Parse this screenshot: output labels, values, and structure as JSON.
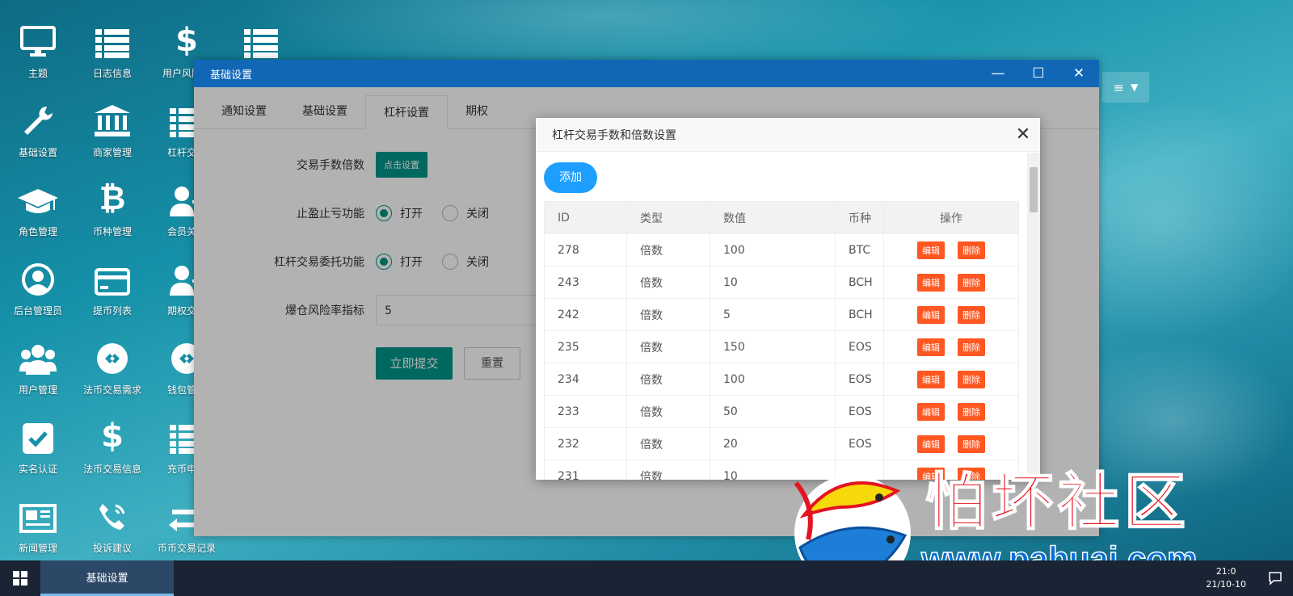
{
  "desktop_icons": [
    {
      "label": "主题",
      "icon": "monitor-icon"
    },
    {
      "label": "日志信息",
      "icon": "list-icon"
    },
    {
      "label": "用户风险率",
      "icon": "dollar-icon"
    },
    {
      "label": "",
      "icon": "list-icon"
    },
    {
      "label": "基础设置",
      "icon": "wrench-icon"
    },
    {
      "label": "商家管理",
      "icon": "bank-icon"
    },
    {
      "label": "杠杆交易",
      "icon": "list-icon"
    },
    {
      "label": "角色管理",
      "icon": "graduation-cap-icon"
    },
    {
      "label": "币种管理",
      "icon": "bitcoin-icon"
    },
    {
      "label": "会员关系",
      "icon": "user-plus-icon"
    },
    {
      "label": "后台管理员",
      "icon": "user-circle-icon"
    },
    {
      "label": "提币列表",
      "icon": "credit-card-icon"
    },
    {
      "label": "期权交易",
      "icon": "user-plus-icon"
    },
    {
      "label": "用户管理",
      "icon": "users-icon"
    },
    {
      "label": "法币交易需求",
      "icon": "exchange-badge-icon"
    },
    {
      "label": "钱包管理",
      "icon": "exchange-badge-icon"
    },
    {
      "label": "实名认证",
      "icon": "checkbox-icon"
    },
    {
      "label": "法币交易信息",
      "icon": "dollar-icon"
    },
    {
      "label": "充币申请",
      "icon": "list-icon"
    },
    {
      "label": "新闻管理",
      "icon": "newspaper-icon"
    },
    {
      "label": "投诉建议",
      "icon": "phone-icon"
    },
    {
      "label": "币币交易记录",
      "icon": "transfer-icon"
    }
  ],
  "window": {
    "title": "基础设置",
    "minimize": "—",
    "maximize": "☐",
    "close": "✕"
  },
  "tabs": [
    "通知设置",
    "基础设置",
    "杠杆设置",
    "期权"
  ],
  "active_tab": "杠杆设置",
  "form": {
    "fee_label": "交易手数倍数",
    "fee_button": "点击设置",
    "stop_label": "止盈止亏功能",
    "entrust_label": "杠杆交易委托功能",
    "open_label": "打开",
    "close_label": "关闭",
    "stop_selected": "打开",
    "entrust_selected": "打开",
    "risk_label": "爆仓风险率指标",
    "risk_value": "5",
    "submit": "立即提交",
    "reset": "重置"
  },
  "dialog": {
    "title": "杠杆交易手数和倍数设置",
    "close": "✕",
    "add_button": "添加",
    "columns": [
      "ID",
      "类型",
      "数值",
      "币种",
      "操作"
    ],
    "edit_label": "编辑",
    "delete_label": "删除",
    "rows": [
      {
        "id": "278",
        "type": "倍数",
        "value": "100",
        "coin": "BTC"
      },
      {
        "id": "243",
        "type": "倍数",
        "value": "10",
        "coin": "BCH"
      },
      {
        "id": "242",
        "type": "倍数",
        "value": "5",
        "coin": "BCH"
      },
      {
        "id": "235",
        "type": "倍数",
        "value": "150",
        "coin": "EOS"
      },
      {
        "id": "234",
        "type": "倍数",
        "value": "100",
        "coin": "EOS"
      },
      {
        "id": "233",
        "type": "倍数",
        "value": "50",
        "coin": "EOS"
      },
      {
        "id": "232",
        "type": "倍数",
        "value": "20",
        "coin": "EOS"
      },
      {
        "id": "231",
        "type": "倍数",
        "value": "10",
        "coin": ""
      }
    ]
  },
  "taskbar": {
    "task": "基础设置",
    "clock_time": "21:0",
    "clock_date": "21/10-10"
  },
  "watermark": {
    "name": "怕坏社区",
    "url": "www.pahuai.com"
  },
  "colors": {
    "titlebar": "#1167b6",
    "primary_green": "#009688",
    "add_blue": "#1e9fff",
    "danger_orange": "#ff5722",
    "taskbar": "#1a2434"
  }
}
